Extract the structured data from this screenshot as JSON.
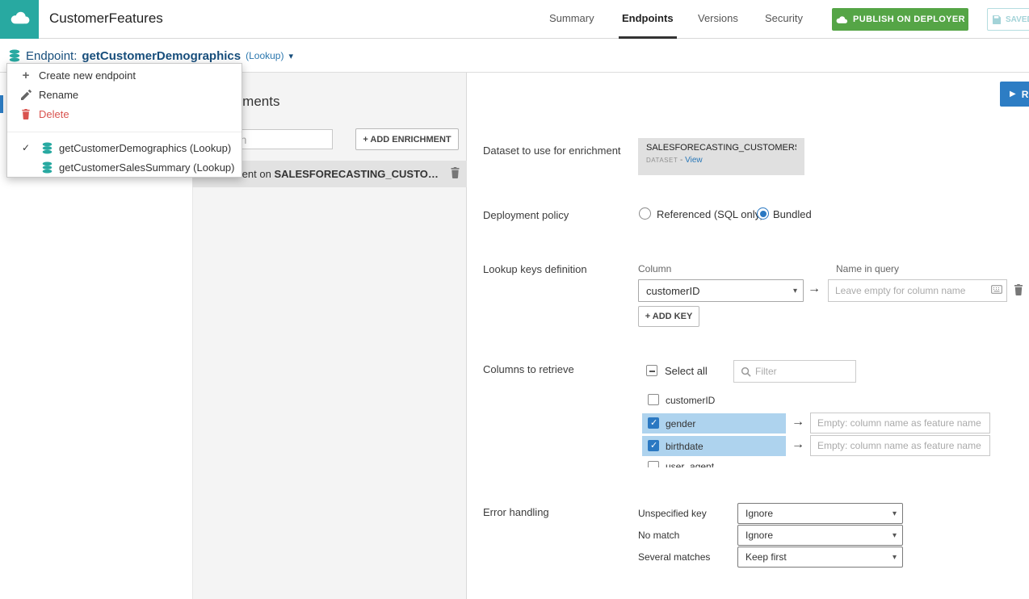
{
  "colors": {
    "teal": "#28a9a1",
    "green": "#55a546",
    "accent_blue": "#2d7dc4",
    "link_blue": "#2777b8",
    "navy": "#174e7c",
    "danger_red": "#d9534f",
    "row_highlight": "#aed3ee",
    "checkbox_blue": "#2a78c2"
  },
  "topbar": {
    "title": "CustomerFeatures",
    "tabs": [
      {
        "label": "Summary",
        "active": false
      },
      {
        "label": "Endpoints",
        "active": true
      },
      {
        "label": "Versions",
        "active": false
      },
      {
        "label": "Security",
        "active": false
      }
    ],
    "publish_label": "PUBLISH ON DEPLOYER",
    "saved_label": "SAVED"
  },
  "endpoint_bar": {
    "prefix": "Endpoint:",
    "name": "getCustomerDemographics",
    "type": "(Lookup)",
    "run_label": "RU"
  },
  "endpoint_menu": {
    "create": "Create new endpoint",
    "rename": "Rename",
    "delete": "Delete",
    "endpoints": [
      {
        "label": "getCustomerDemographics (Lookup)",
        "selected": true
      },
      {
        "label": "getCustomerSalesSummary (Lookup)",
        "selected": false
      }
    ]
  },
  "enrichments": {
    "title": "Enrichments",
    "search_placeholder": "Search",
    "add_button": "+ ADD ENRICHMENT",
    "selected_item": {
      "prefix": "Enrichment on ",
      "dataset": "SALESFORECASTING_CUSTO…"
    }
  },
  "panel": {
    "dataset": {
      "label": "Dataset to use for enrichment",
      "name": "SALESFORECASTING_CUSTOMERS_I…",
      "kind": "DATASET",
      "sep": " - ",
      "view": "View"
    },
    "deployment": {
      "label": "Deployment policy",
      "options": [
        {
          "label": "Referenced (SQL only)",
          "selected": false
        },
        {
          "label": "Bundled",
          "selected": true
        }
      ]
    },
    "lookup": {
      "label": "Lookup keys definition",
      "column_header": "Column",
      "name_header": "Name in query",
      "column_value": "customerID",
      "name_placeholder": "Leave empty for column name",
      "add_key": "+ ADD KEY"
    },
    "columns": {
      "label": "Columns to retrieve",
      "select_all": "Select all",
      "filter_placeholder": "Filter",
      "feature_placeholder": "Empty: column name as feature name",
      "rows": [
        {
          "name": "customerID",
          "checked": false
        },
        {
          "name": "gender",
          "checked": true
        },
        {
          "name": "birthdate",
          "checked": true
        },
        {
          "name": "user_agent",
          "checked": false
        }
      ]
    },
    "errors": {
      "label": "Error handling",
      "rows": [
        {
          "label": "Unspecified key",
          "value": "Ignore"
        },
        {
          "label": "No match",
          "value": "Ignore"
        },
        {
          "label": "Several matches",
          "value": "Keep first"
        }
      ]
    }
  }
}
